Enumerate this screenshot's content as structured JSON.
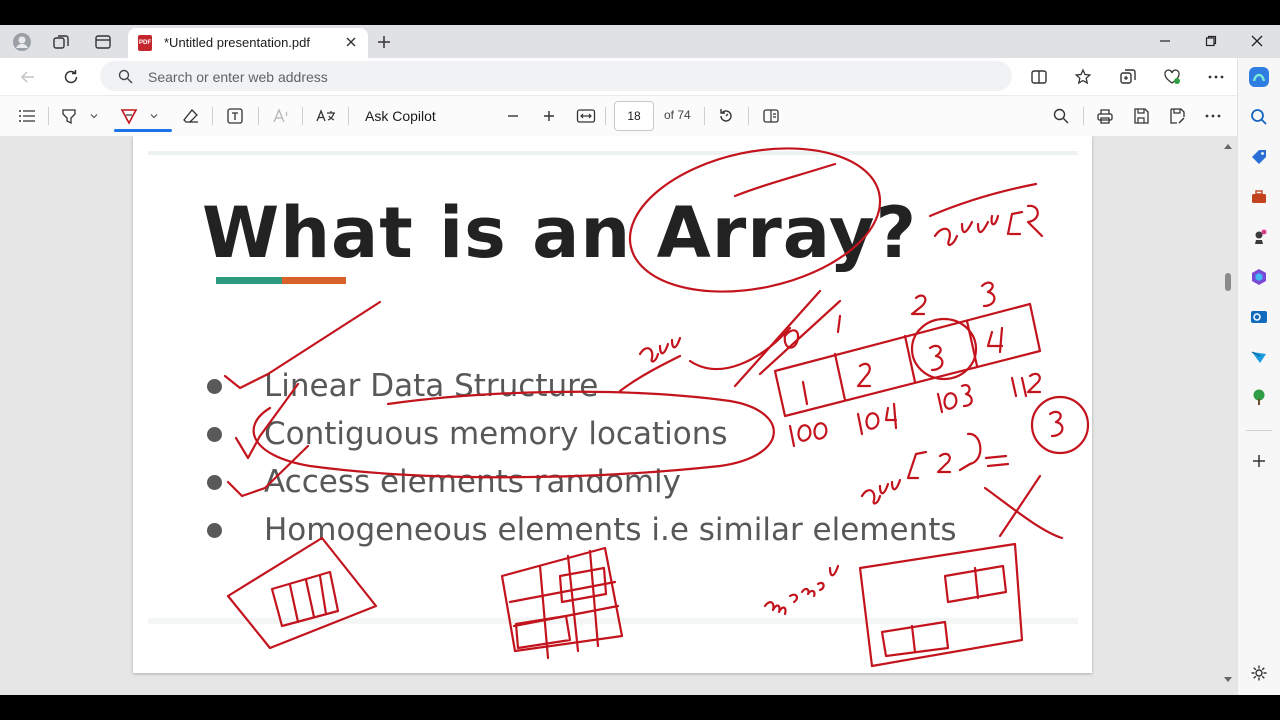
{
  "browser": {
    "tab_title": "*Untitled presentation.pdf",
    "address_placeholder": "Search or enter web address"
  },
  "pdf_toolbar": {
    "copilot_label": "Ask Copilot",
    "page_number": "18",
    "page_total": "of 74"
  },
  "slide": {
    "title": "What is an Array?",
    "bullets": [
      "Linear Data Structure",
      "Contiguous memory locations",
      "Access elements randomly",
      "Homogeneous elements i.e similar elements"
    ]
  },
  "colors": {
    "ink": "#c3141e",
    "title_bar_green": "#2e9a7f",
    "title_bar_orange": "#d9622b"
  }
}
